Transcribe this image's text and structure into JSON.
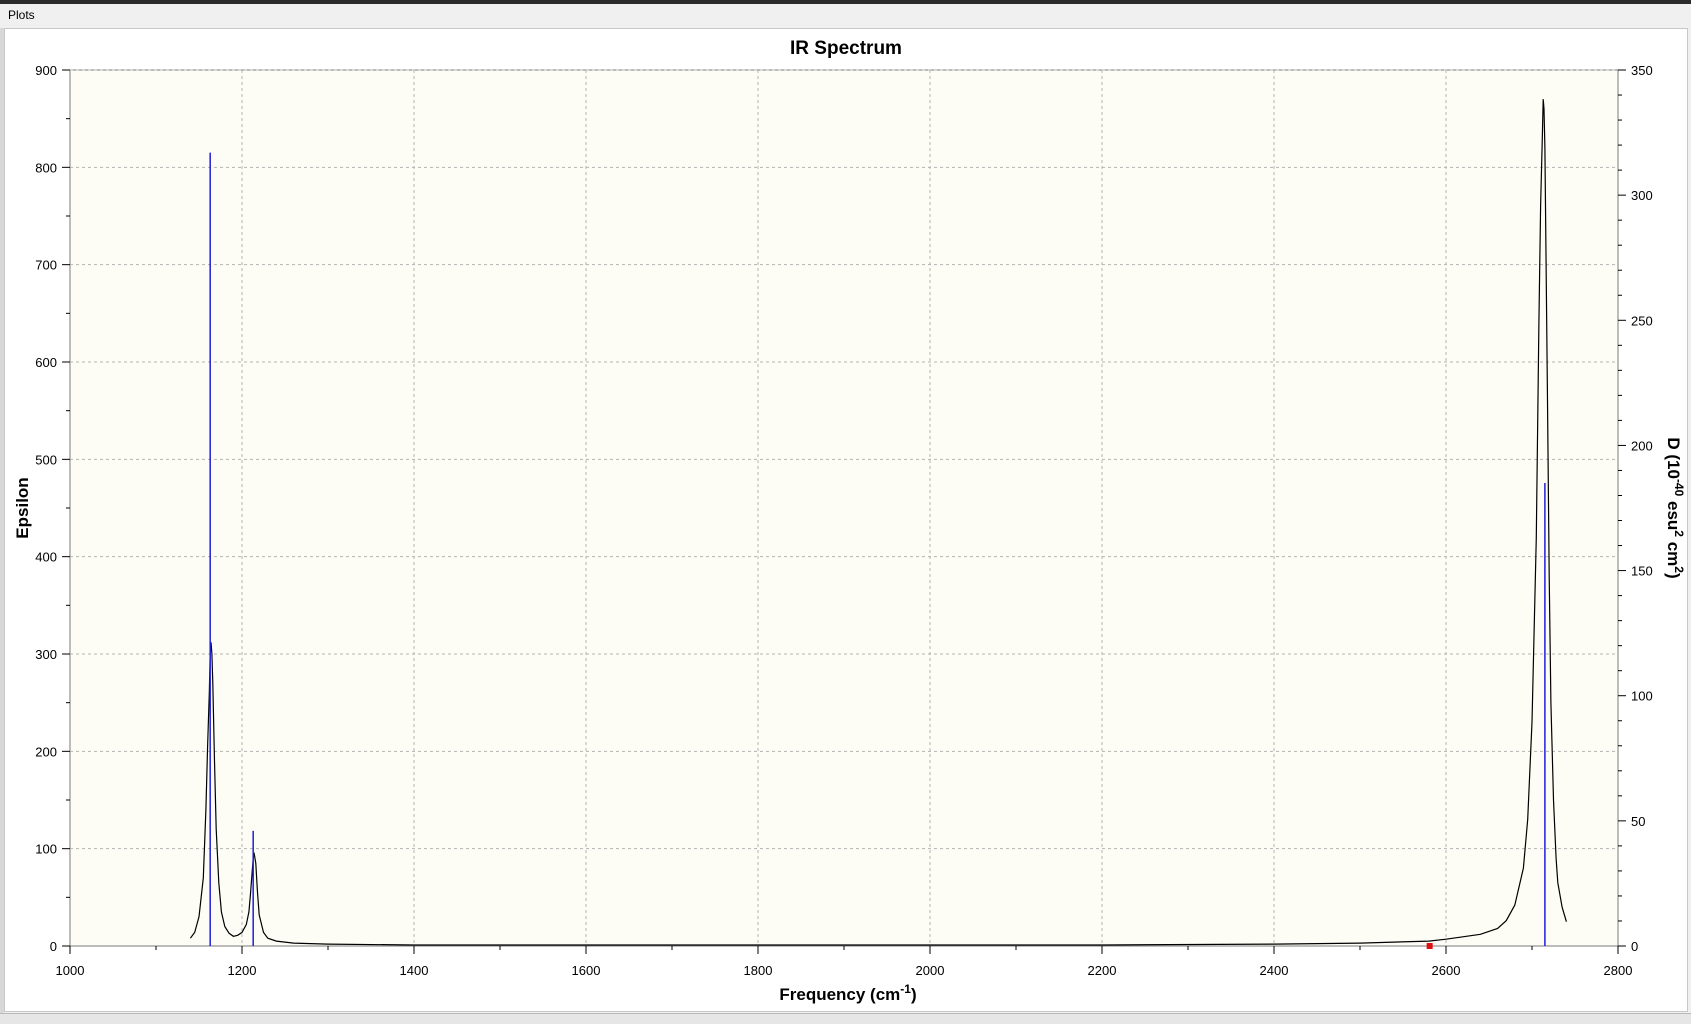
{
  "window": {
    "title": "Plots"
  },
  "colors": {
    "plot_background": "#fdfdf6",
    "grid": "#b4b4b4",
    "spectrum_line": "#000000",
    "stick_line": "#1f1fdc",
    "marker": "#e01010"
  },
  "chart_data": {
    "type": "line",
    "title": "IR Spectrum",
    "xlabel": "Frequency (cm-1)",
    "ylabel": "Epsilon",
    "y2label": "D (10-40 esu2 cm2)",
    "xlim": [
      1000,
      2800
    ],
    "ylim": [
      0,
      900
    ],
    "y2lim": [
      0,
      350
    ],
    "x_ticks": [
      1000,
      1200,
      1400,
      1600,
      1800,
      2000,
      2200,
      2400,
      2600,
      2800
    ],
    "y_ticks": [
      0,
      100,
      200,
      300,
      400,
      500,
      600,
      700,
      800,
      900
    ],
    "y2_ticks": [
      0,
      50,
      100,
      150,
      200,
      250,
      300,
      350
    ],
    "grid": true,
    "series": [
      {
        "kind": "spectrum",
        "axis": "left",
        "x": [
          1140,
          1145,
          1150,
          1155,
          1158,
          1160,
          1162,
          1163,
          1164,
          1165,
          1166,
          1168,
          1170,
          1173,
          1176,
          1180,
          1185,
          1190,
          1195,
          1200,
          1205,
          1208,
          1210,
          1212,
          1213,
          1214,
          1216,
          1218,
          1220,
          1225,
          1230,
          1240,
          1260,
          1300,
          1400,
          1600,
          1800,
          2000,
          2200,
          2400,
          2500,
          2580,
          2600,
          2640,
          2660,
          2670,
          2680,
          2690,
          2695,
          2700,
          2705,
          2708,
          2710,
          2712,
          2713,
          2714,
          2715,
          2716,
          2718,
          2720,
          2722,
          2725,
          2728,
          2730,
          2735,
          2740
        ],
        "y": [
          8,
          14,
          30,
          70,
          140,
          205,
          260,
          300,
          312,
          300,
          270,
          190,
          120,
          65,
          35,
          20,
          13,
          10,
          11,
          14,
          22,
          35,
          55,
          78,
          90,
          96,
          85,
          55,
          32,
          14,
          8,
          5,
          3,
          2,
          1,
          1,
          1,
          1,
          1,
          2,
          3,
          5,
          7,
          12,
          18,
          26,
          42,
          80,
          130,
          230,
          420,
          640,
          760,
          830,
          870,
          860,
          820,
          730,
          560,
          380,
          250,
          150,
          90,
          65,
          40,
          25
        ]
      },
      {
        "kind": "stick",
        "axis": "right",
        "x": [
          1163,
          1213,
          2715
        ],
        "y": [
          317,
          46,
          185
        ]
      }
    ],
    "markers": [
      {
        "x": 2581,
        "y": 0
      }
    ]
  }
}
